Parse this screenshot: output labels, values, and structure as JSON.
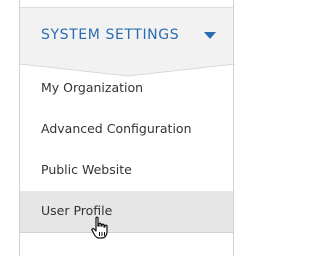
{
  "section": {
    "title": "SYSTEM SETTINGS",
    "expanded": true,
    "toggle_icon": "chevron-down-icon",
    "accent_color": "#2b6cb0"
  },
  "menu": {
    "items": [
      {
        "label": "My Organization",
        "active": false
      },
      {
        "label": "Advanced Configuration",
        "active": false
      },
      {
        "label": "Public Website",
        "active": false
      },
      {
        "label": "User Profile",
        "active": true
      }
    ]
  },
  "cursor": {
    "icon": "hand-pointer-icon"
  }
}
